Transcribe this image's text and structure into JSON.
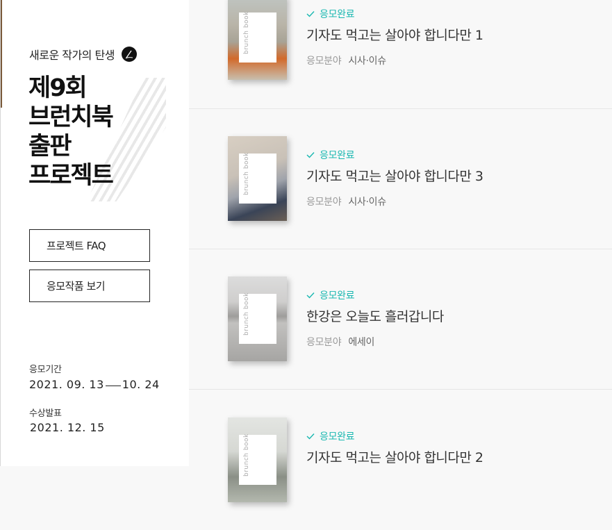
{
  "sidebar": {
    "tagline": "새로운 작가의 탄생",
    "title_lines": [
      "제9회",
      "브런치북",
      "출판",
      "프로젝트"
    ],
    "buttons": {
      "faq": "프로젝트 FAQ",
      "view": "응모작품 보기"
    },
    "period": {
      "label": "응모기간",
      "start": "2021. 09. 13",
      "end": "10. 24"
    },
    "award": {
      "label": "수상발표",
      "date": "2021. 12. 15"
    }
  },
  "entries": [
    {
      "status": "응모완료",
      "title": "기자도 먹고는 살아야 합니다만 1",
      "field_label": "응모분야",
      "field": "시사·이슈",
      "cover_text": "brunch book"
    },
    {
      "status": "응모완료",
      "title": "기자도 먹고는 살아야 합니다만 3",
      "field_label": "응모분야",
      "field": "시사·이슈",
      "cover_text": "brunch book"
    },
    {
      "status": "응모완료",
      "title": "한강은 오늘도 흘러갑니다",
      "field_label": "응모분야",
      "field": "에세이",
      "cover_text": "brunch book"
    },
    {
      "status": "응모완료",
      "title": "기자도 먹고는 살아야 합니다만 2",
      "field_label": "응모분야",
      "field": "",
      "cover_text": "brunch book"
    }
  ],
  "colors": {
    "accent": "#18b7b0"
  }
}
